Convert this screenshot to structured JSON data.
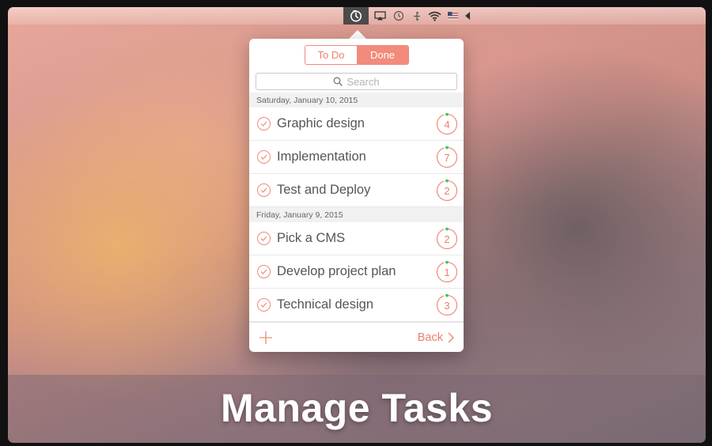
{
  "menubar": {
    "icons": [
      "timer-icon",
      "airplay-icon",
      "time-machine-icon",
      "bluetooth-icon",
      "wifi-icon",
      "flag-icon",
      "volume-icon"
    ]
  },
  "popup": {
    "segments": [
      {
        "label": "To Do",
        "selected": false
      },
      {
        "label": "Done",
        "selected": true
      }
    ],
    "search_placeholder": "Search",
    "sections": [
      {
        "date": "Saturday, January 10, 2015",
        "tasks": [
          {
            "label": "Graphic design",
            "count": "4"
          },
          {
            "label": "Implementation",
            "count": "7"
          },
          {
            "label": "Test and Deploy",
            "count": "2"
          }
        ]
      },
      {
        "date": "Friday, January 9, 2015",
        "tasks": [
          {
            "label": "Pick a CMS",
            "count": "2"
          },
          {
            "label": "Develop project plan",
            "count": "1"
          },
          {
            "label": "Technical design",
            "count": "3"
          }
        ]
      }
    ],
    "back_label": "Back"
  },
  "banner": {
    "title": "Manage Tasks"
  },
  "colors": {
    "accent": "#f28b7b",
    "progress_dot": "#4cc35a"
  }
}
